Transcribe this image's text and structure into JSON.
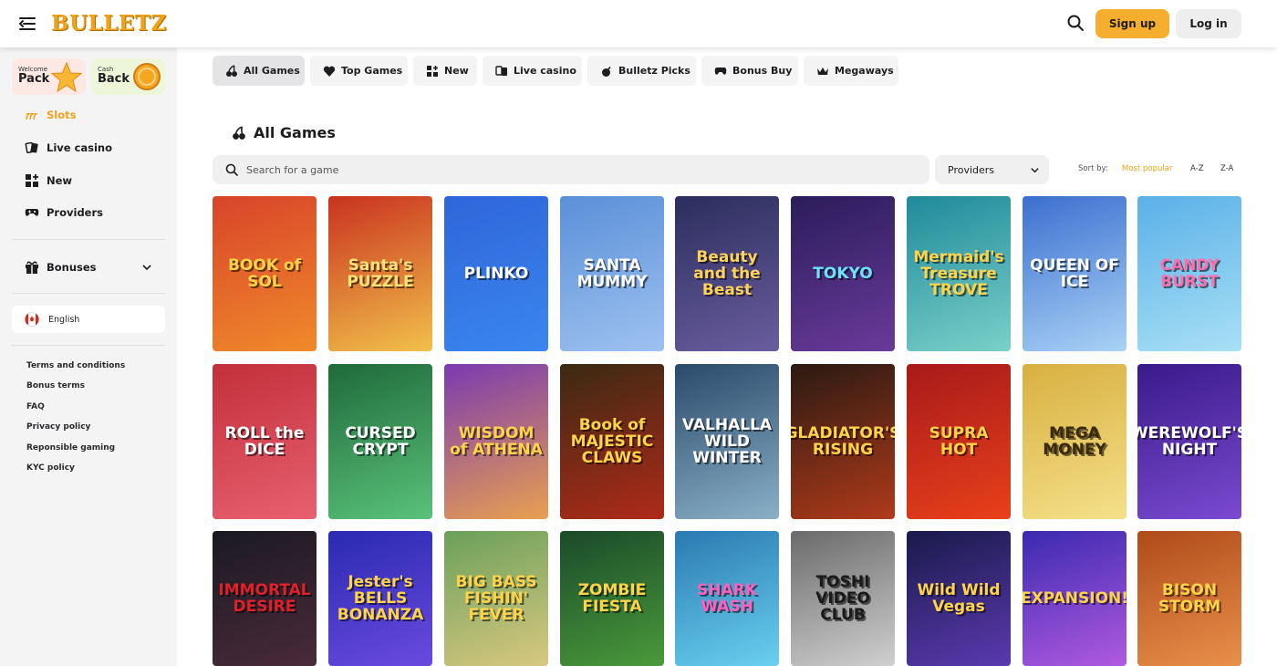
{
  "header": {
    "logo": "BULLETZ",
    "signup_label": "Sign up",
    "login_label": "Log in",
    "icons": {
      "menu": "menu-collapse-icon",
      "search": "search-icon"
    },
    "accent_color": "#F5AE2D"
  },
  "sidebar": {
    "promos": {
      "welcome": {
        "small": "Welcome",
        "big": "Pack"
      },
      "cashback": {
        "small": "Cash",
        "big": "Back"
      }
    },
    "nav": [
      {
        "label": "Slots",
        "icon": "cherries-icon",
        "active": true
      },
      {
        "label": "Live casino",
        "icon": "cards-icon",
        "active": false
      },
      {
        "label": "New",
        "icon": "grid-plus-icon",
        "active": false
      },
      {
        "label": "Providers",
        "icon": "gamepad-icon",
        "active": false
      }
    ],
    "bonuses_label": "Bonuses",
    "language": "English",
    "footer_links": [
      "Terms and conditions",
      "Bonus terms",
      "FAQ",
      "Privacy policy",
      "Reponsible gaming",
      "KYC policy"
    ]
  },
  "tabs": [
    {
      "label": "All Games",
      "icon": "cherries-icon",
      "active": true
    },
    {
      "label": "Top Games",
      "icon": "heart-icon",
      "active": false
    },
    {
      "label": "New",
      "icon": "grid-plus-icon",
      "active": false
    },
    {
      "label": "Live casino",
      "icon": "cards-icon",
      "active": false
    },
    {
      "label": "Bulletz Picks",
      "icon": "bomb-icon",
      "active": false
    },
    {
      "label": "Bonus Buy",
      "icon": "gamepad-icon",
      "active": false
    },
    {
      "label": "Megaways",
      "icon": "crown-icon",
      "active": false
    }
  ],
  "main": {
    "title": "All Games",
    "search_placeholder": "Search for a game",
    "providers_label": "Providers",
    "sort_label": "Sort by:",
    "sort_options": [
      "Most popular",
      "A-Z",
      "Z-A"
    ],
    "sort_active": "Most popular"
  },
  "games": [
    {
      "name": "BOOK of SOL",
      "bg": "#d8442a",
      "bg2": "#f08a2a",
      "fg": "#ffd34a"
    },
    {
      "name": "Santa's PUZZLE",
      "bg": "#c9321f",
      "bg2": "#f1c14a",
      "fg": "#ffe27a"
    },
    {
      "name": "PLINKO",
      "bg": "#2e66d8",
      "bg2": "#3b86f0",
      "fg": "#ffffff"
    },
    {
      "name": "SANTA MUMMY",
      "bg": "#5a8fd8",
      "bg2": "#9ec2f0",
      "fg": "#ffffff"
    },
    {
      "name": "Beauty and the Beast",
      "bg": "#2b2e5e",
      "bg2": "#6a5d9e",
      "fg": "#ffd25a"
    },
    {
      "name": "TOKYO",
      "bg": "#2a1d5a",
      "bg2": "#6a3a9a",
      "fg": "#6be3ff"
    },
    {
      "name": "Mermaid's Treasure TROVE",
      "bg": "#1f8a9a",
      "bg2": "#7ad0c8",
      "fg": "#ffd34a"
    },
    {
      "name": "QUEEN OF ICE",
      "bg": "#3b6fd0",
      "bg2": "#a9d2f5",
      "fg": "#ffffff"
    },
    {
      "name": "CANDY BURST",
      "bg": "#5ab0e8",
      "bg2": "#a8e0f5",
      "fg": "#ff6fb0"
    },
    {
      "name": "ROLL the DICE",
      "bg": "#c2303a",
      "bg2": "#e86070",
      "fg": "#ffffff"
    },
    {
      "name": "CURSED CRYPT",
      "bg": "#1f6a3a",
      "bg2": "#5ac27a",
      "fg": "#ffffff"
    },
    {
      "name": "WISDOM of ATHENA",
      "bg": "#7a3ab0",
      "bg2": "#e8a050",
      "fg": "#ffd34a"
    },
    {
      "name": "Book of MAJESTIC CLAWS",
      "bg": "#3a2a12",
      "bg2": "#b02a1a",
      "fg": "#ffd34a"
    },
    {
      "name": "VALHALLA WILD WINTER",
      "bg": "#2a4a6a",
      "bg2": "#8ab0c8",
      "fg": "#ffffff"
    },
    {
      "name": "GLADIATOR'S RISING",
      "bg": "#2a1a12",
      "bg2": "#b03a1a",
      "fg": "#ffd34a"
    },
    {
      "name": "SUPRA HOT",
      "bg": "#a81a1a",
      "bg2": "#e8401a",
      "fg": "#ffd34a"
    },
    {
      "name": "MEGA MONEY",
      "bg": "#d8b040",
      "bg2": "#f5e08a",
      "fg": "#3a2a0a"
    },
    {
      "name": "WEREWOLF'S NIGHT",
      "bg": "#3a1a8a",
      "bg2": "#7a4ad0",
      "fg": "#ffffff"
    },
    {
      "name": "IMMORTAL DESIRE",
      "bg": "#1a1a22",
      "bg2": "#4a2a3a",
      "fg": "#e0202a"
    },
    {
      "name": "Jester's BELLS BONANZA",
      "bg": "#2a2ab0",
      "bg2": "#6a4ae0",
      "fg": "#ffd34a"
    },
    {
      "name": "BIG BASS FISHIN' FEVER",
      "bg": "#6aa05a",
      "bg2": "#d8c880",
      "fg": "#ffd34a"
    },
    {
      "name": "ZOMBIE FIESTA",
      "bg": "#1a4a2a",
      "bg2": "#4a9a3a",
      "fg": "#ffd34a"
    },
    {
      "name": "SHARK WASH",
      "bg": "#2a7ab0",
      "bg2": "#6ad0f0",
      "fg": "#ff60c0"
    },
    {
      "name": "TOSHI VIDEO CLUB",
      "bg": "#6a6a6a",
      "bg2": "#d0d0d0",
      "fg": "#1a1a1a"
    },
    {
      "name": "Wild Wild Vegas",
      "bg": "#1a1a4a",
      "bg2": "#5a3ab0",
      "fg": "#ffd34a"
    },
    {
      "name": "EXPANSION!",
      "bg": "#3a2ab0",
      "bg2": "#b05ae0",
      "fg": "#ffd34a"
    },
    {
      "name": "BISON STORM",
      "bg": "#b04a1a",
      "bg2": "#e8904a",
      "fg": "#ffd34a"
    }
  ]
}
